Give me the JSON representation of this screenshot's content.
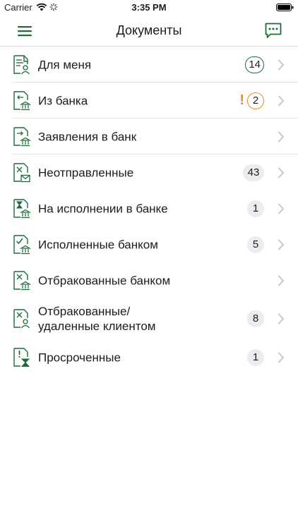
{
  "status": {
    "carrier": "Carrier",
    "time": "3:35 PM"
  },
  "nav": {
    "title": "Документы"
  },
  "rows": [
    {
      "label": "Для меня",
      "badge": "14"
    },
    {
      "label": "Из банка",
      "badge": "2",
      "alert": "!"
    },
    {
      "label": "Заявления в банк"
    },
    {
      "label": "Неотправленные",
      "badge": "43"
    },
    {
      "label": "На исполнении в банке",
      "badge": "1"
    },
    {
      "label": "Исполненные банком",
      "badge": "5"
    },
    {
      "label": "Отбракованные банком"
    },
    {
      "label": "Отбракованные/",
      "label_line2": "удаленные клиентом",
      "badge": "8"
    },
    {
      "label": "Просроченные",
      "badge": "1"
    }
  ],
  "colors": {
    "accent": "#1f6b3a",
    "alert": "#e88a2a",
    "badge_bg": "#ececf0"
  }
}
